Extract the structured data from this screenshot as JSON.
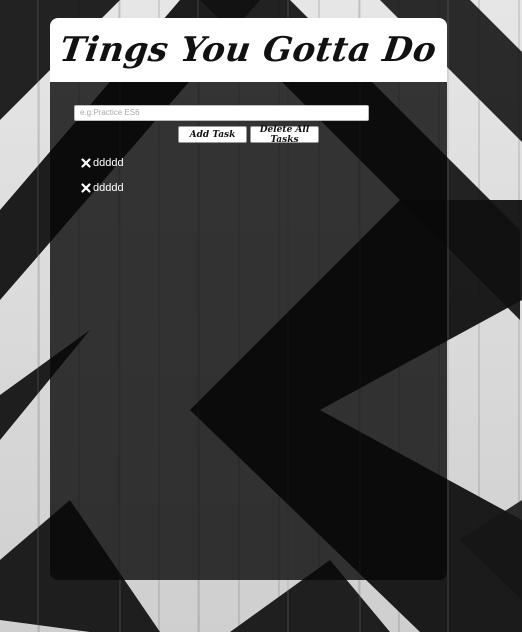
{
  "app": {
    "title": "Tings You Gotta Do"
  },
  "input": {
    "placeholder": "e.g:Practice ES6",
    "value": ""
  },
  "buttons": {
    "add_label": "Add Task",
    "delete_all_label": "Delete All Tasks"
  },
  "tasks": [
    {
      "text": "ddddd",
      "icon": "close-icon"
    },
    {
      "text": "ddddd",
      "icon": "close-icon"
    }
  ],
  "colors": {
    "card_bg": "#0b0b0b",
    "header_bg": "#ffffff",
    "text_light": "#ffffff"
  }
}
